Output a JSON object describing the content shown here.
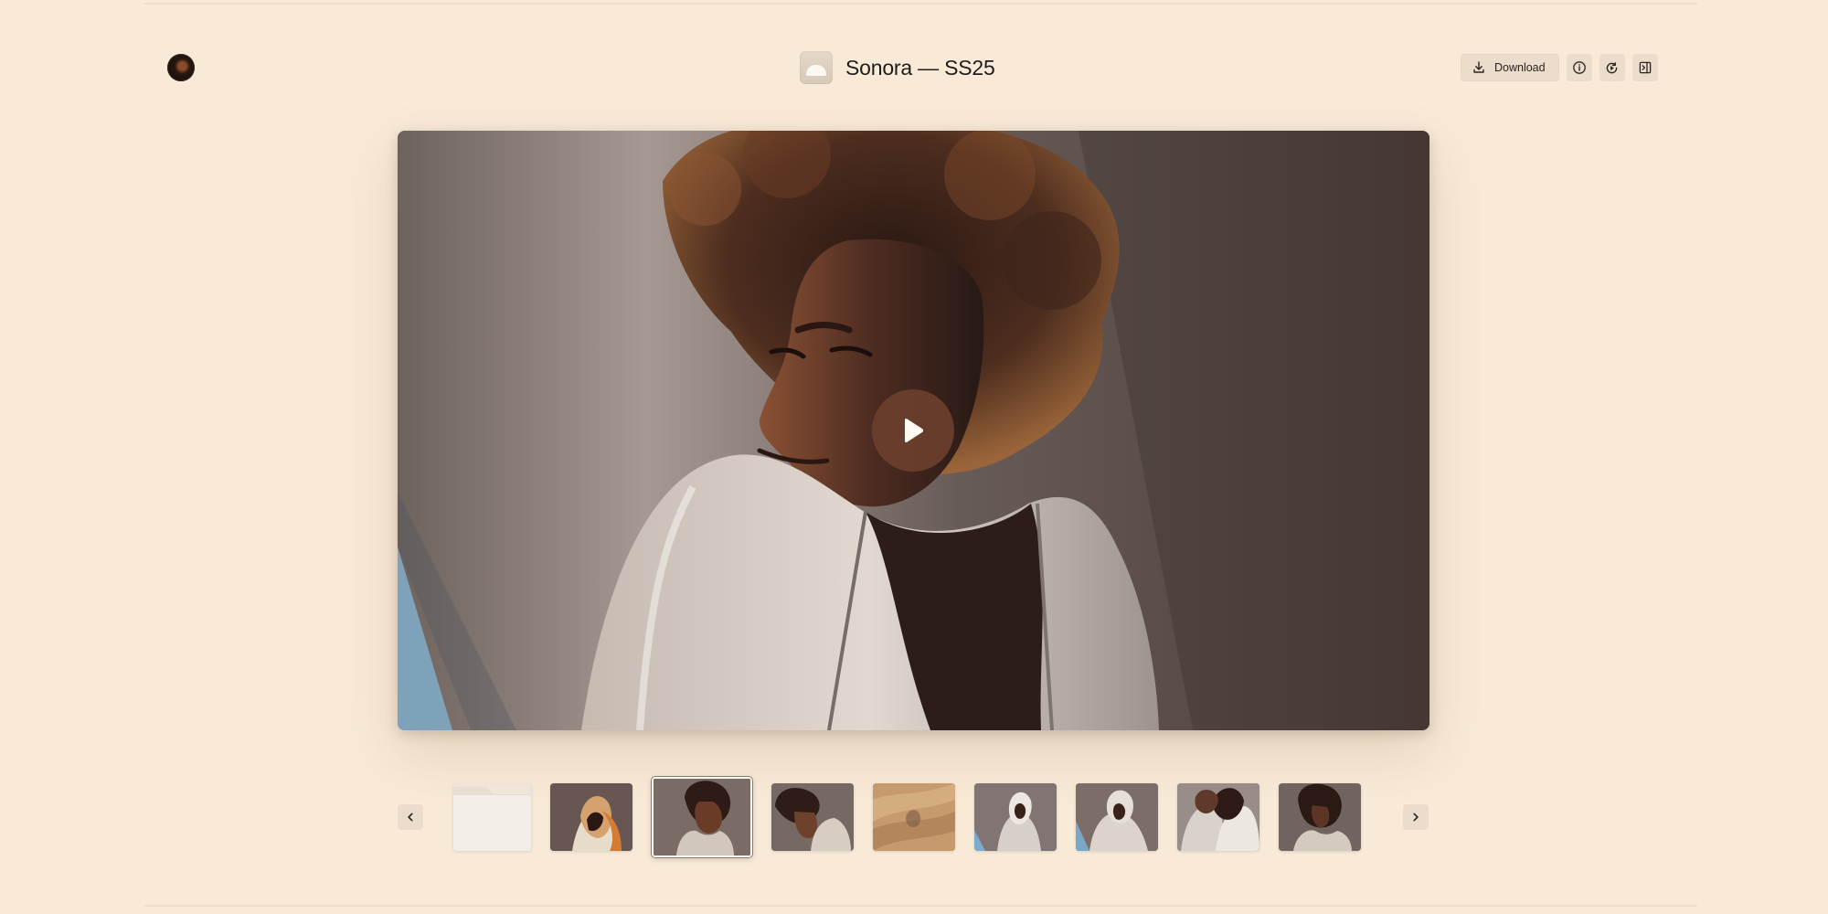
{
  "header": {
    "title": "Sonora — SS25",
    "actions": {
      "download_label": "Download"
    }
  },
  "icons": {
    "profile": "avatar",
    "app": "app-icon",
    "download": "download-icon",
    "info": "info-icon",
    "replay": "replay-icon",
    "panel": "panel-toggle-icon",
    "play": "play-icon",
    "previous": "chevron-left-icon",
    "next": "chevron-right-icon"
  },
  "gallery": {
    "selected_index": 2,
    "thumbnails": [
      {
        "kind": "folder"
      },
      {
        "kind": "portrait-hood-orange"
      },
      {
        "kind": "portrait-afro-selected"
      },
      {
        "kind": "portrait-afro-side"
      },
      {
        "kind": "sand-texture"
      },
      {
        "kind": "portrait-hood-white"
      },
      {
        "kind": "portrait-hood-white-2"
      },
      {
        "kind": "two-models"
      },
      {
        "kind": "portrait-afro-front"
      }
    ]
  },
  "colors": {
    "background": "#f8ead7",
    "button": "#ebdccb",
    "play": "#6b3f2d"
  }
}
